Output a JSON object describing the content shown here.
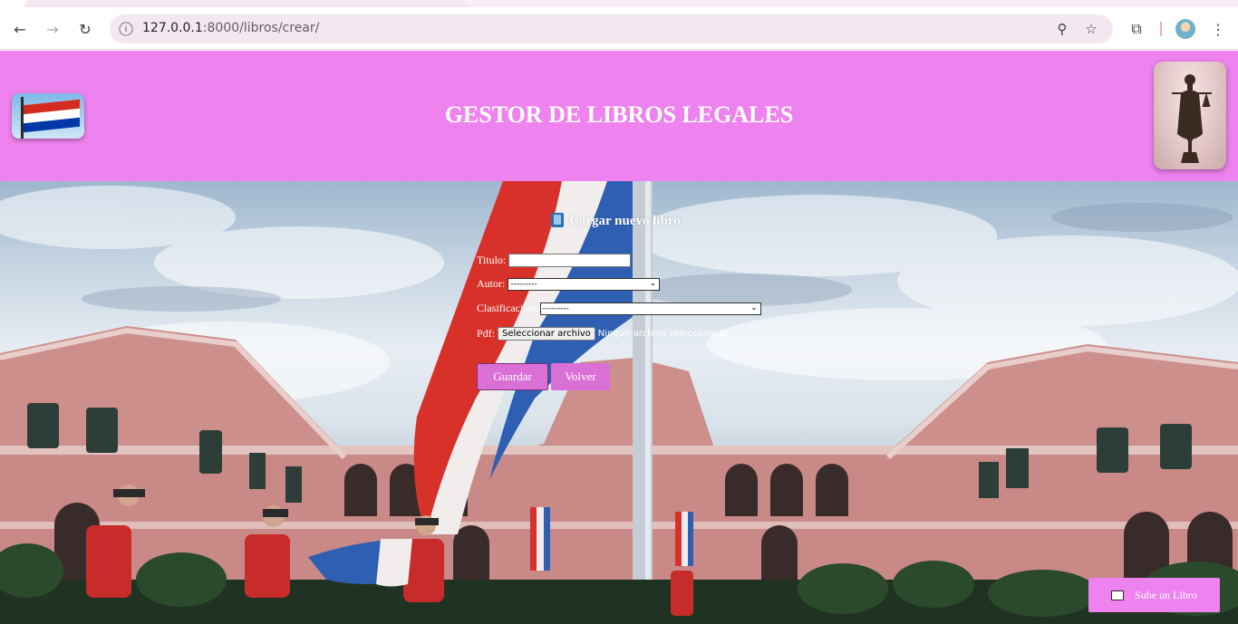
{
  "browser": {
    "url_host": "127.0.0.1",
    "url_path": ":8000/libros/crear/",
    "icons": {
      "back": "back-arrow-icon",
      "forward": "forward-arrow-icon",
      "reload": "reload-icon",
      "site_info": "site-info-icon",
      "zoom": "zoom-icon",
      "bookmark": "star-icon",
      "extensions": "extensions-icon",
      "menu": "kebab-menu-icon"
    }
  },
  "header": {
    "title": "GESTOR DE LIBROS LEGALES",
    "background_color": "#ee82ee"
  },
  "form": {
    "heading": "Cargar nuevo libro",
    "fields": {
      "titulo_label": "Titulo:",
      "titulo_value": "",
      "autor_label": "Autor:",
      "autor_selected": "---------",
      "clasificacion_label": "Clasificacion:",
      "clasificacion_selected": "---------",
      "pdf_label": "Pdf:",
      "file_button": "Seleccionar archivo",
      "file_status": "Ningún archivo seleccionado"
    },
    "buttons": {
      "save": "Guardar",
      "back": "Volver"
    },
    "button_color": "#da70d6"
  },
  "floating": {
    "upload_label": "Sube un Libro"
  }
}
